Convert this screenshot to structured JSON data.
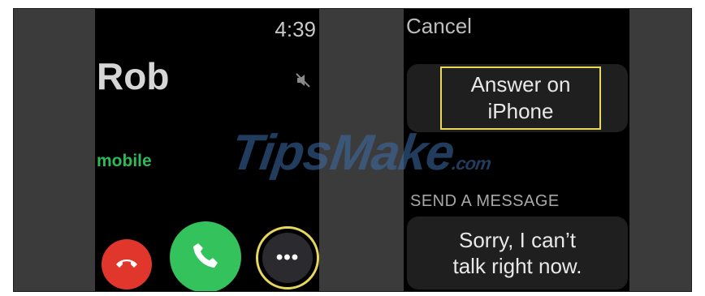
{
  "call_screen": {
    "time": "4:39",
    "caller_name": "Rob",
    "caller_label": "mobile",
    "icons": {
      "mute": "mute-speaker-icon",
      "decline": "phone-hangup-icon",
      "accept": "phone-icon",
      "more": "ellipsis-icon"
    },
    "more_glyph": "•••"
  },
  "options_screen": {
    "cancel_label": "Cancel",
    "answer_on_iphone_label": "Answer on\niPhone",
    "send_message_header": "SEND A MESSAGE",
    "messages": [
      "Sorry, I can’t\ntalk right now."
    ]
  },
  "watermark": {
    "text": "TipsMake",
    "suffix": ".com"
  },
  "colors": {
    "accent_highlight": "#e8d85a",
    "decline_red": "#e0362c",
    "accept_green": "#33c25c",
    "label_green": "#2eb85a"
  }
}
